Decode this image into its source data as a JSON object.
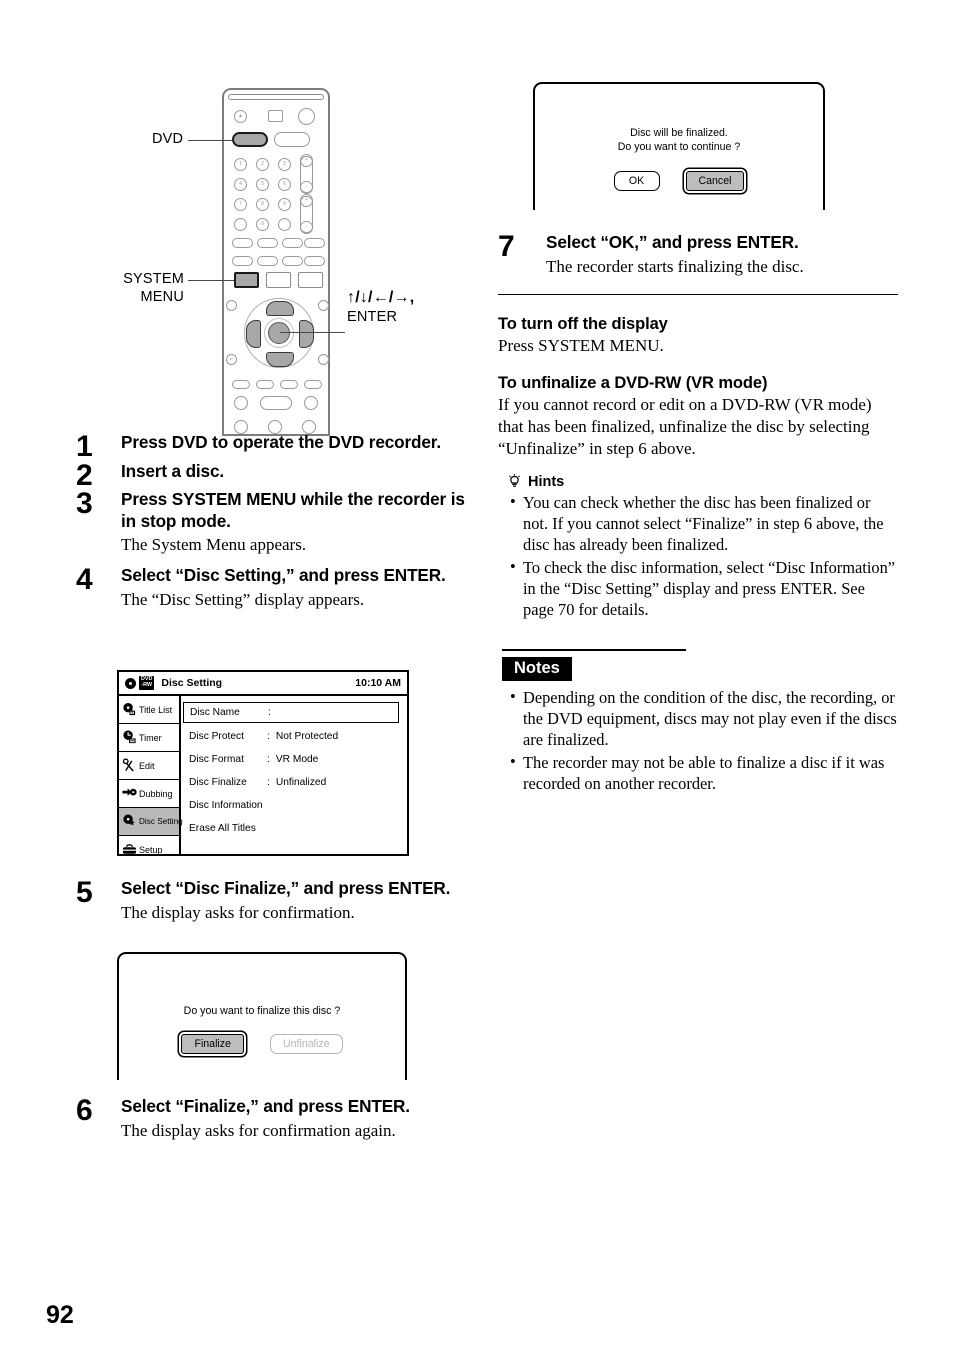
{
  "page": {
    "number": "92"
  },
  "remote": {
    "callouts": {
      "dvd": "DVD",
      "system_menu_line1": "SYSTEM",
      "system_menu_line2": "MENU",
      "dpad_line1": "↑/↓/←/→,",
      "dpad_line2": "ENTER"
    },
    "numeric_keys": [
      "1",
      "2",
      "3",
      "4",
      "5",
      "6",
      "7",
      "8",
      "9",
      "0"
    ]
  },
  "steps": [
    {
      "num": "1",
      "head": "Press DVD to operate the DVD recorder.",
      "sub": ""
    },
    {
      "num": "2",
      "head": "Insert a disc.",
      "sub": ""
    },
    {
      "num": "3",
      "head": "Press SYSTEM MENU while the recorder is in stop mode.",
      "sub": "The System Menu appears."
    },
    {
      "num": "4",
      "head": "Select “Disc Setting,” and press ENTER.",
      "sub": "The “Disc Setting” display appears."
    },
    {
      "num": "5",
      "head": "Select “Disc Finalize,” and press ENTER.",
      "sub": "The display asks for confirmation."
    },
    {
      "num": "6",
      "head": "Select “Finalize,” and press ENTER.",
      "sub": "The display asks for confirmation again."
    },
    {
      "num": "7",
      "head": "Select “OK,” and press ENTER.",
      "sub": "The recorder starts finalizing the disc."
    }
  ],
  "osd": {
    "disc_icon": "disc-icon",
    "media_badge_line1": "DVD",
    "media_badge_line2": "-RW",
    "title": "Disc Setting",
    "clock": "10:10 AM",
    "sidebar": [
      {
        "label": "Title List",
        "icon": "title-list-icon",
        "selected": false
      },
      {
        "label": "Timer",
        "icon": "timer-icon",
        "selected": false
      },
      {
        "label": "Edit",
        "icon": "scissors-icon",
        "selected": false
      },
      {
        "label": "Dubbing",
        "icon": "dubbing-icon",
        "selected": false
      },
      {
        "label": "Disc Setting",
        "icon": "disc-setting-icon",
        "selected": true
      },
      {
        "label": "Setup",
        "icon": "toolbox-icon",
        "selected": false
      }
    ],
    "rows": [
      {
        "key": "Disc Name",
        "sep": ":",
        "value": "",
        "boxed": true
      },
      {
        "key": "Disc Protect",
        "sep": ":",
        "value": "Not Protected",
        "boxed": false
      },
      {
        "key": "Disc Format",
        "sep": ":",
        "value": "VR Mode",
        "boxed": false
      },
      {
        "key": "Disc Finalize",
        "sep": ":",
        "value": "Unfinalized",
        "boxed": false
      },
      {
        "key": "Disc Information",
        "sep": "",
        "value": "",
        "boxed": false
      },
      {
        "key": "Erase All Titles",
        "sep": "",
        "value": "",
        "boxed": false
      }
    ]
  },
  "dialog_finalize": {
    "message": "Do you want to finalize this disc ?",
    "buttons": [
      {
        "label": "Finalize",
        "state": "selected"
      },
      {
        "label": "Unfinalize",
        "state": "disabled"
      }
    ]
  },
  "dialog_confirm": {
    "message_line1": "Disc will be finalized.",
    "message_line2": "Do you want to continue ?",
    "buttons": [
      {
        "label": "OK",
        "state": "normal"
      },
      {
        "label": "Cancel",
        "state": "selected"
      }
    ]
  },
  "sections": {
    "turn_off_display": {
      "heading": "To turn off the display",
      "body": "Press SYSTEM MENU."
    },
    "unfinalize": {
      "heading": "To unfinalize a DVD-RW (VR mode)",
      "body": "If you cannot record or edit on a DVD-RW (VR mode) that has been finalized, unfinalize the disc by selecting “Unfinalize” in step 6 above."
    },
    "hints": {
      "heading": "Hints",
      "icon": "lightbulb-icon",
      "items": [
        "You can check whether the disc has been finalized or not. If you cannot select “Finalize” in step 6 above, the disc has already been finalized.",
        "To check the disc information, select “Disc Information” in the “Disc Setting” display and press ENTER. See page 70 for details."
      ]
    },
    "notes": {
      "heading": "Notes",
      "items": [
        "Depending on the condition of the disc, the recording, or the DVD equipment, discs may not play even if the discs are finalized.",
        "The recorder may not be able to finalize a disc if it was recorded on another recorder."
      ]
    }
  }
}
